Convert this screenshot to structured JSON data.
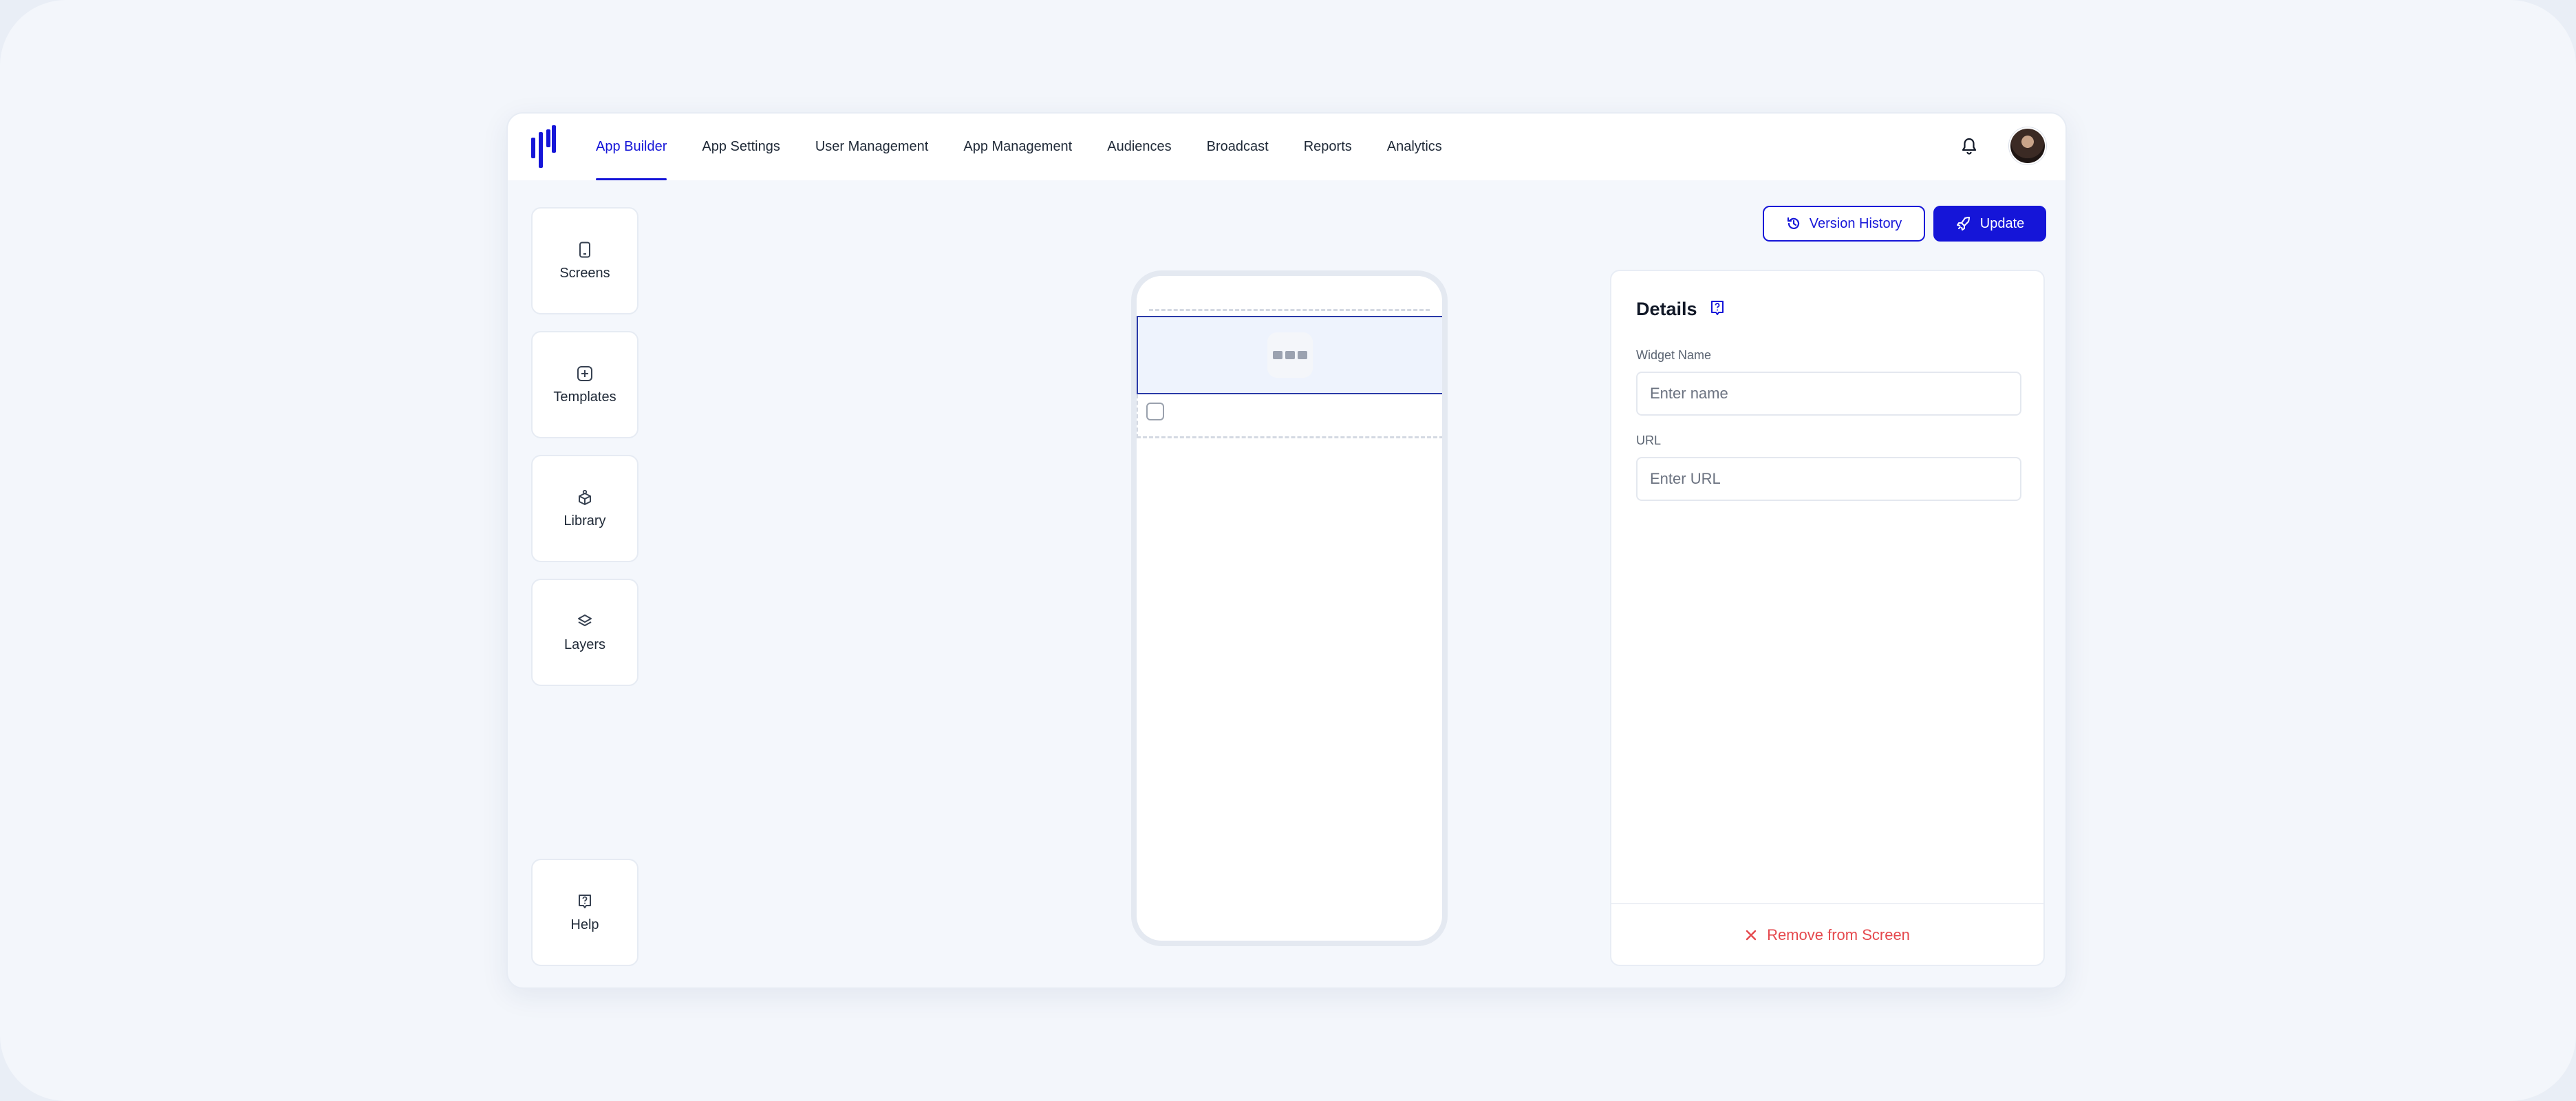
{
  "nav": {
    "items": [
      {
        "label": "App Builder",
        "active": true
      },
      {
        "label": "App Settings"
      },
      {
        "label": "User Management"
      },
      {
        "label": "App Management"
      },
      {
        "label": "Audiences"
      },
      {
        "label": "Broadcast"
      },
      {
        "label": "Reports"
      },
      {
        "label": "Analytics"
      }
    ]
  },
  "tools": {
    "screens": {
      "label": "Screens",
      "icon": "phone-icon"
    },
    "templates": {
      "label": "Templates",
      "icon": "plus-square-icon"
    },
    "library": {
      "label": "Library",
      "icon": "box-icon"
    },
    "layers": {
      "label": "Layers",
      "icon": "layers-icon"
    },
    "help": {
      "label": "Help",
      "icon": "help-icon"
    }
  },
  "actions": {
    "version_history": "Version History",
    "update": "Update"
  },
  "details": {
    "title": "Details",
    "widget_name_label": "Widget Name",
    "widget_name_placeholder": "Enter name",
    "widget_name_value": "",
    "url_label": "URL",
    "url_placeholder": "Enter URL",
    "url_value": "",
    "remove_label": "Remove from Screen"
  },
  "colors": {
    "accent": "#1515d8",
    "danger": "#e5484d",
    "page_bg": "#f3f6fb"
  }
}
